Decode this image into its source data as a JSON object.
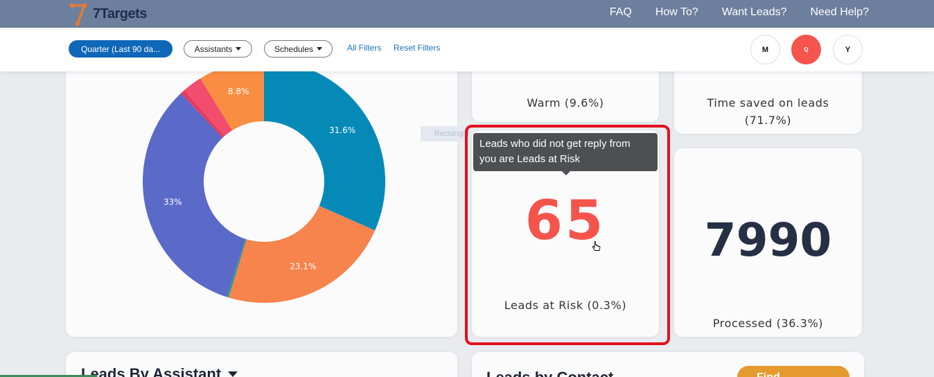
{
  "app": {
    "brand": "7Targets",
    "brand_accent": "#e07b39",
    "nav_links": [
      "FAQ",
      "How To?",
      "Want Leads?",
      "Need Help?"
    ]
  },
  "filters": {
    "period": "Quarter (Last 90 da...",
    "assistants": "Assistants",
    "schedules": "Schedules",
    "all_filters": "All Filters",
    "reset_filters": "Reset Filters",
    "periods": [
      "M",
      "Q",
      "Y"
    ],
    "active_period": "Q"
  },
  "ghost_label": "Rectangular Snip",
  "chart_data": {
    "type": "pie",
    "labels": [
      "31.6%",
      "23.1%",
      "33%",
      "8.8%"
    ],
    "slices": [
      {
        "value": 31.6,
        "color": "#058ab8",
        "label": "31.6%"
      },
      {
        "value": 23.1,
        "color": "#f7834d",
        "label": "23.1%"
      },
      {
        "value": 0.3,
        "color": "#2e9a8c",
        "label": ""
      },
      {
        "value": 33.0,
        "color": "#5b69c9",
        "label": "33%"
      },
      {
        "value": 0.6,
        "color": "#e83a5c",
        "label": ""
      },
      {
        "value": 2.6,
        "color": "#f24d6d",
        "label": ""
      },
      {
        "value": 8.8,
        "color": "#f98e42",
        "label": "8.8%"
      }
    ]
  },
  "stats": {
    "warm": {
      "label": "Warm (9.6%)"
    },
    "time_saved": {
      "label_line1": "Time saved on leads",
      "label_line2": "(71.7%)"
    },
    "risk": {
      "value": "65",
      "label": "Leads at Risk (0.3%)",
      "color": "#f4544c"
    },
    "processed": {
      "value": "7990",
      "label": "Processed (36.3%)"
    }
  },
  "tooltip": {
    "line1": "Leads who did not get reply from",
    "line2": "you are Leads at Risk"
  },
  "bottom": {
    "left_title": "Leads By Assistant",
    "right_title": "Leads by Contact",
    "button_label": "Find..."
  }
}
